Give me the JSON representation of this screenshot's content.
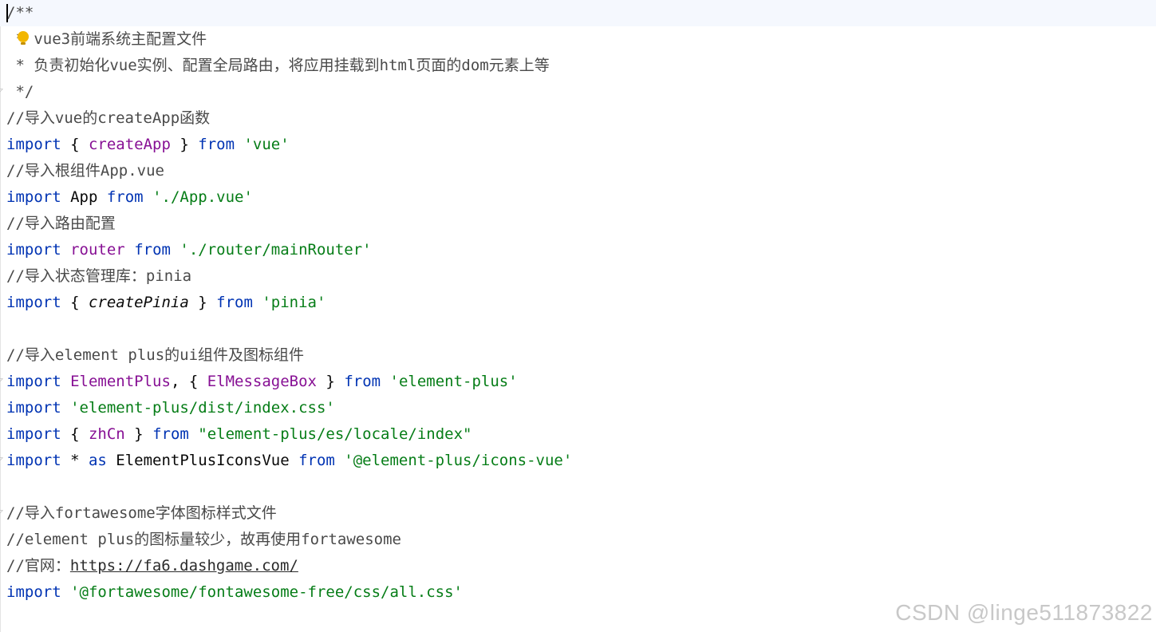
{
  "editor": {
    "lines": [
      [
        {
          "t": "/**",
          "c": "comment"
        }
      ],
      [
        {
          "t": " * vue3前端系统主配置文件",
          "c": "comment"
        }
      ],
      [
        {
          "t": " * 负责初始化vue实例、配置全局路由，将应用挂载到html页面的dom元素上等",
          "c": "comment"
        }
      ],
      [
        {
          "t": " */",
          "c": "comment"
        }
      ],
      [
        {
          "t": "//导入vue的createApp函数",
          "c": "comment"
        }
      ],
      [
        {
          "t": "import",
          "c": "keyword"
        },
        {
          "t": " { ",
          "c": "plain"
        },
        {
          "t": "createApp",
          "c": "name"
        },
        {
          "t": " } ",
          "c": "plain"
        },
        {
          "t": "from",
          "c": "keyword"
        },
        {
          "t": " ",
          "c": "plain"
        },
        {
          "t": "'vue'",
          "c": "string"
        }
      ],
      [
        {
          "t": "//导入根组件App.vue",
          "c": "comment"
        }
      ],
      [
        {
          "t": "import",
          "c": "keyword"
        },
        {
          "t": " App ",
          "c": "plain"
        },
        {
          "t": "from",
          "c": "keyword"
        },
        {
          "t": " ",
          "c": "plain"
        },
        {
          "t": "'./App.vue'",
          "c": "string"
        }
      ],
      [
        {
          "t": "//导入路由配置",
          "c": "comment"
        }
      ],
      [
        {
          "t": "import",
          "c": "keyword"
        },
        {
          "t": " ",
          "c": "plain"
        },
        {
          "t": "router",
          "c": "name"
        },
        {
          "t": " ",
          "c": "plain"
        },
        {
          "t": "from",
          "c": "keyword"
        },
        {
          "t": " ",
          "c": "plain"
        },
        {
          "t": "'./router/mainRouter'",
          "c": "string"
        }
      ],
      [
        {
          "t": "//导入状态管理库：pinia",
          "c": "comment"
        }
      ],
      [
        {
          "t": "import",
          "c": "keyword"
        },
        {
          "t": " { ",
          "c": "plain"
        },
        {
          "t": "createPinia",
          "c": "italic"
        },
        {
          "t": " } ",
          "c": "plain"
        },
        {
          "t": "from",
          "c": "keyword"
        },
        {
          "t": " ",
          "c": "plain"
        },
        {
          "t": "'pinia'",
          "c": "string"
        }
      ],
      [],
      [
        {
          "t": "//导入element plus的ui组件及图标组件",
          "c": "comment"
        }
      ],
      [
        {
          "t": "import",
          "c": "keyword"
        },
        {
          "t": " ",
          "c": "plain"
        },
        {
          "t": "ElementPlus",
          "c": "name"
        },
        {
          "t": ", { ",
          "c": "plain"
        },
        {
          "t": "ElMessageBox",
          "c": "name"
        },
        {
          "t": " } ",
          "c": "plain"
        },
        {
          "t": "from",
          "c": "keyword"
        },
        {
          "t": " ",
          "c": "plain"
        },
        {
          "t": "'element-plus'",
          "c": "string"
        }
      ],
      [
        {
          "t": "import",
          "c": "keyword"
        },
        {
          "t": " ",
          "c": "plain"
        },
        {
          "t": "'element-plus/dist/index.css'",
          "c": "string"
        }
      ],
      [
        {
          "t": "import",
          "c": "keyword"
        },
        {
          "t": " { ",
          "c": "plain"
        },
        {
          "t": "zhCn",
          "c": "name"
        },
        {
          "t": " } ",
          "c": "plain"
        },
        {
          "t": "from",
          "c": "keyword"
        },
        {
          "t": " ",
          "c": "plain"
        },
        {
          "t": "\"element-plus/es/locale/index\"",
          "c": "string"
        }
      ],
      [
        {
          "t": "import",
          "c": "keyword"
        },
        {
          "t": " * ",
          "c": "plain"
        },
        {
          "t": "as",
          "c": "keyword"
        },
        {
          "t": " ElementPlusIconsVue ",
          "c": "plain"
        },
        {
          "t": "from",
          "c": "keyword"
        },
        {
          "t": " ",
          "c": "plain"
        },
        {
          "t": "'@element-plus/icons-vue'",
          "c": "string"
        }
      ],
      [],
      [
        {
          "t": "//导入fortawesome字体图标样式文件",
          "c": "comment"
        }
      ],
      [
        {
          "t": "//element plus的图标量较少，故再使用fortawesome",
          "c": "comment"
        }
      ],
      [
        {
          "t": "//官网：",
          "c": "comment"
        },
        {
          "t": "https://fa6.dashgame.com/",
          "c": "link"
        }
      ],
      [
        {
          "t": "import",
          "c": "keyword"
        },
        {
          "t": " ",
          "c": "plain"
        },
        {
          "t": "'@fortawesome/fontawesome-free/css/all.css'",
          "c": "string"
        }
      ]
    ]
  },
  "watermark": {
    "text": "CSDN @linge511873822"
  }
}
